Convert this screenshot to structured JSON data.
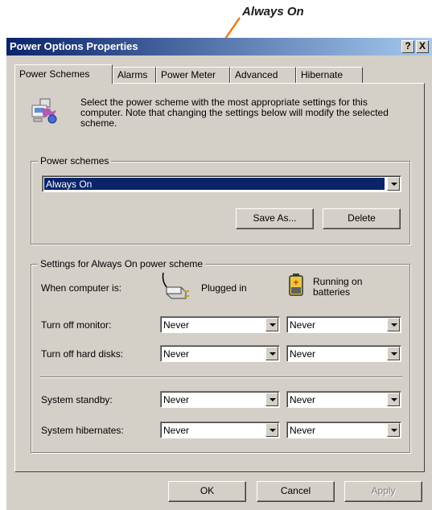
{
  "annotation": {
    "label": "Always On",
    "arrow_color": "#f07b1b"
  },
  "window": {
    "title": "Power Options Properties",
    "help_label": "?",
    "close_label": "X",
    "title_gradient": [
      "#0a246a",
      "#a6caf0"
    ]
  },
  "tabs": [
    {
      "label": "Power Schemes",
      "active": true
    },
    {
      "label": "Alarms",
      "active": false
    },
    {
      "label": "Power Meter",
      "active": false
    },
    {
      "label": "Advanced",
      "active": false
    },
    {
      "label": "Hibernate",
      "active": false
    }
  ],
  "description": "Select the power scheme with the most appropriate settings for this computer. Note that changing the settings below will modify the selected scheme.",
  "power_schemes": {
    "group_label": "Power schemes",
    "selected": "Always On",
    "save_as_label": "Save As...",
    "delete_label": "Delete"
  },
  "settings": {
    "group_label": "Settings for Always On power scheme",
    "when_label": "When computer is:",
    "plugged_label": "Plugged in",
    "batteries_label": "Running on batteries",
    "rows": [
      {
        "label": "Turn off monitor:",
        "plugged": "Never",
        "battery": "Never"
      },
      {
        "label": "Turn off hard disks:",
        "plugged": "Never",
        "battery": "Never"
      },
      {
        "label": "System standby:",
        "plugged": "Never",
        "battery": "Never"
      },
      {
        "label": "System hibernates:",
        "plugged": "Never",
        "battery": "Never"
      }
    ]
  },
  "buttons": {
    "ok": "OK",
    "cancel": "Cancel",
    "apply": "Apply"
  },
  "icons": [
    "power-scheme-icon",
    "power-plug-icon",
    "battery-icon",
    "chevron-down-icon"
  ]
}
